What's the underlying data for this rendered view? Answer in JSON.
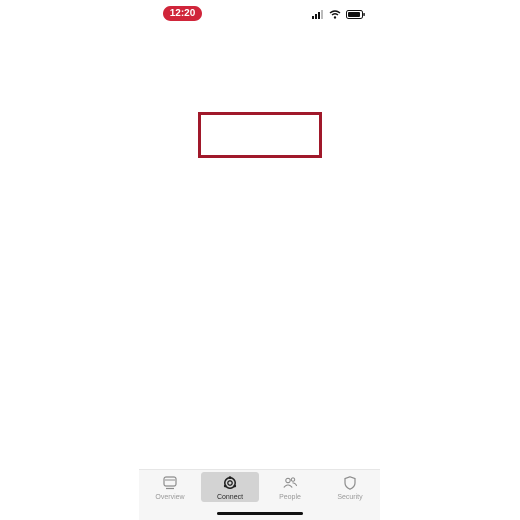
{
  "status_bar": {
    "time": "12:20",
    "time_pill_color": "#d0253a",
    "icons": [
      "signal-icon",
      "wifi-icon",
      "battery-icon"
    ]
  },
  "highlight_box": {
    "border_color": "#a0182a"
  },
  "tab_bar": {
    "items": [
      {
        "label": "Overview",
        "icon": "overview-icon",
        "active": false
      },
      {
        "label": "Connect",
        "icon": "connect-icon",
        "active": true
      },
      {
        "label": "People",
        "icon": "people-icon",
        "active": false
      },
      {
        "label": "Security",
        "icon": "shield-icon",
        "active": false
      }
    ]
  }
}
